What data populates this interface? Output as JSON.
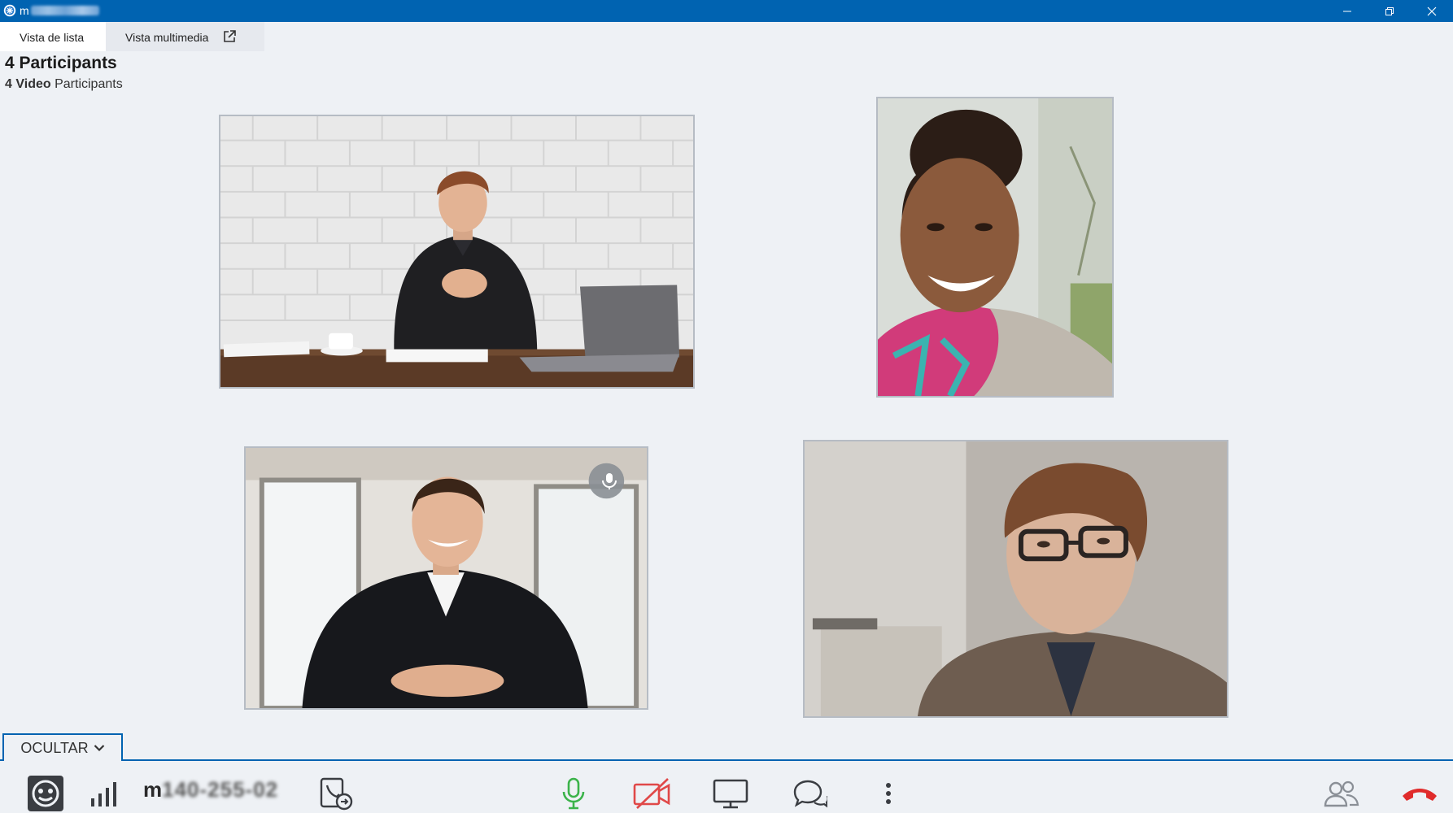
{
  "window": {
    "title_prefix": "m",
    "title_obscured": true,
    "controls": [
      "minimize",
      "restore",
      "close"
    ]
  },
  "tabs": [
    {
      "label": "Vista de lista",
      "active": true
    },
    {
      "label": "Vista multimedia",
      "active": false
    }
  ],
  "summary": {
    "participants_count": "4",
    "participants_label": "Participants",
    "video_count": "4",
    "video_label": "Video",
    "video_suffix": "Participants"
  },
  "participants": [
    {
      "tile": 1,
      "icon": "video-feed"
    },
    {
      "tile": 2,
      "icon": "video-feed"
    },
    {
      "tile": 3,
      "icon": "video-feed",
      "badge": "speaker-icon"
    },
    {
      "tile": 4,
      "icon": "video-feed"
    }
  ],
  "panel": {
    "hide_label": "OCULTAR"
  },
  "toolbar": {
    "caller_prefix": "m",
    "caller_obscured": "140-255-02",
    "icons": [
      "avatar-icon",
      "signal-strength-icon",
      "call-transfer-icon",
      "microphone-icon",
      "camera-off-icon",
      "screen-share-icon",
      "chat-icon",
      "more-options-icon",
      "participants-icon",
      "hang-up-icon"
    ]
  },
  "colors": {
    "titlebar": "#0063b1",
    "mic": "#3bb34a",
    "camera_off": "#e04848",
    "hangup": "#e02b2b",
    "background": "#eef1f5"
  }
}
